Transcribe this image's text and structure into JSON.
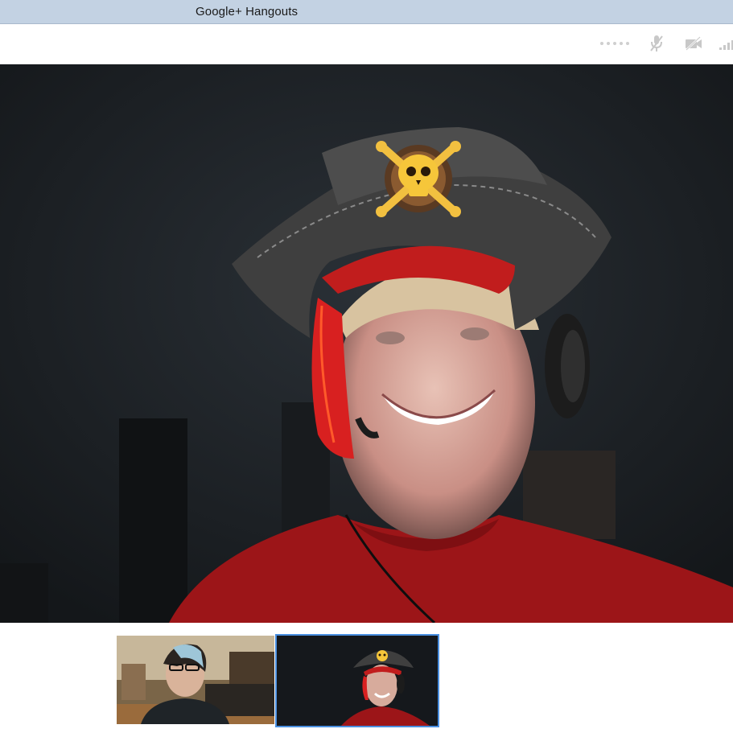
{
  "window": {
    "title": "Google+ Hangouts"
  },
  "toolbar": {
    "icons": [
      "connection-dots-icon",
      "mic-muted-icon",
      "camera-off-icon",
      "signal-bars-icon"
    ],
    "icon_color": "#c8c8c8"
  },
  "main_video": {
    "background": "#1d2125",
    "effect": "pirate-hat"
  },
  "participants": [
    {
      "thumbnail": "participant-1",
      "selected": false
    },
    {
      "thumbnail": "participant-2-pirate",
      "selected": true
    }
  ],
  "colors": {
    "titlebar": "#c3d2e3",
    "selected_border": "#4a8fe0"
  }
}
